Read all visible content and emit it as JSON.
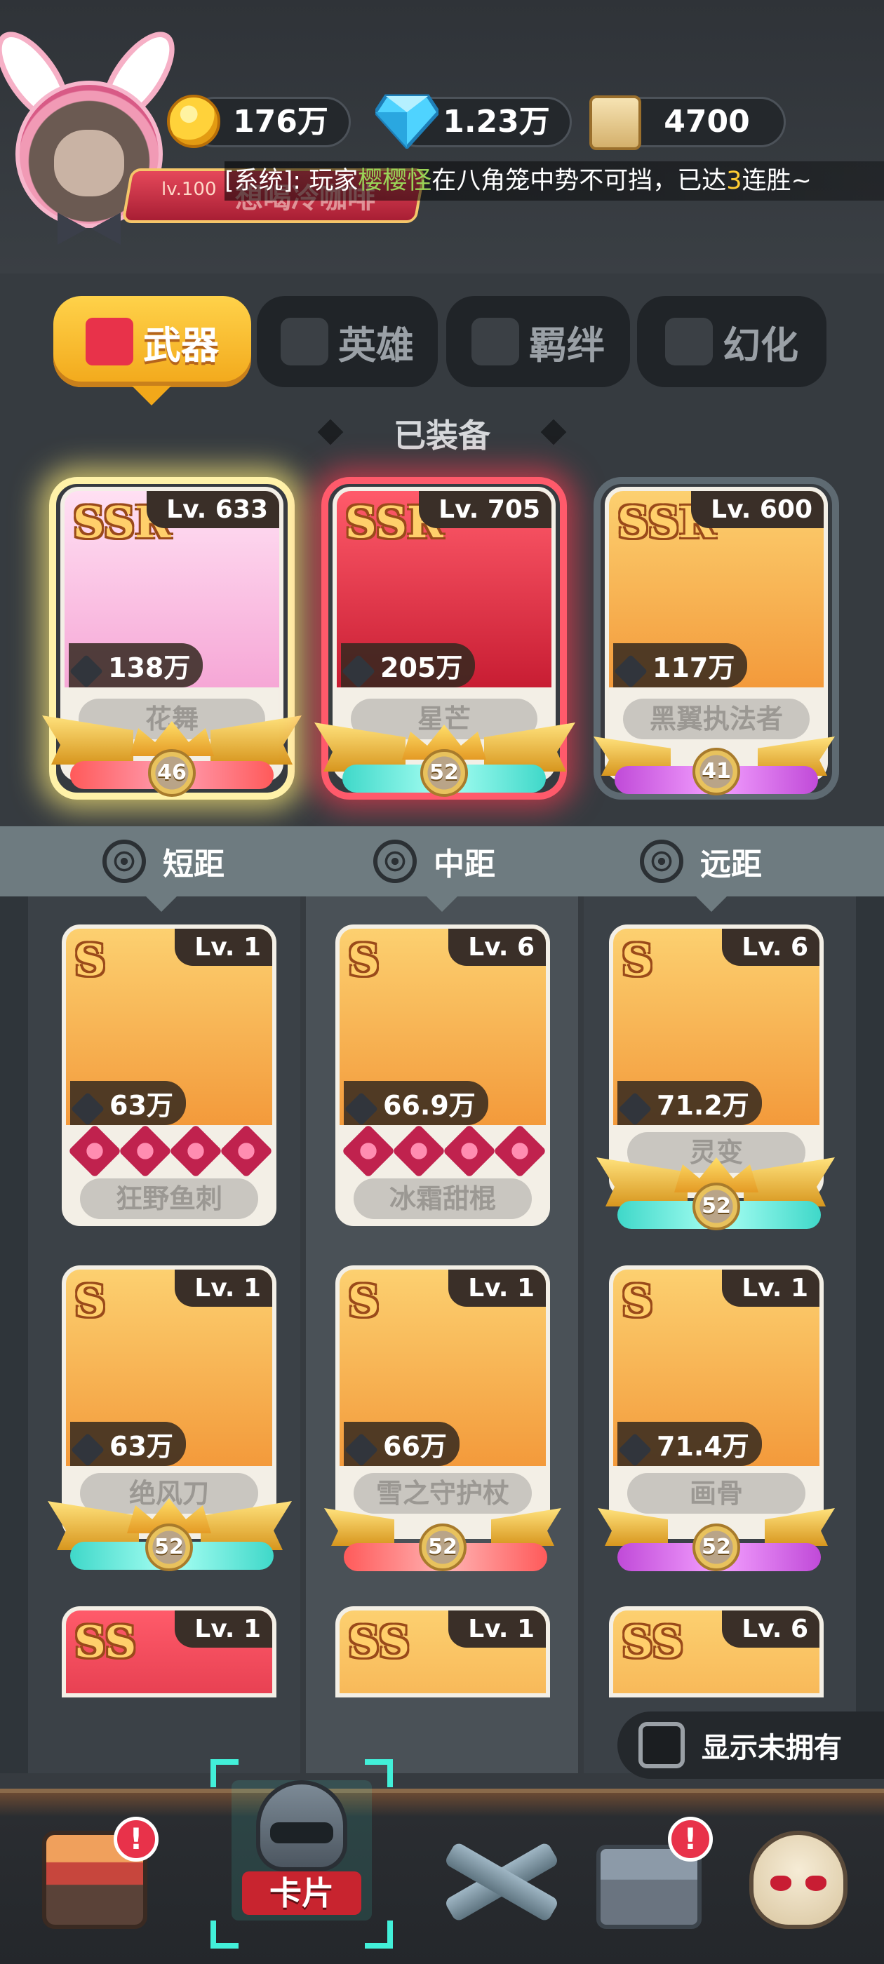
{
  "player": {
    "level": "lv.100",
    "name": "想喝冷咖啡"
  },
  "resources": {
    "coins": "176万",
    "diamonds": "1.23万",
    "scrolls": "4700"
  },
  "ticker": {
    "prefix": "[系统]: 玩家",
    "player": "樱樱怪",
    "middle": "在八角笼中势不可挡，已达",
    "count": "3",
    "suffix": "连胜~"
  },
  "tabs": [
    {
      "label": "武器",
      "icon": "weapon-icon",
      "active": true
    },
    {
      "label": "英雄",
      "icon": "hero-icon",
      "active": false
    },
    {
      "label": "羁绊",
      "icon": "bond-icon",
      "active": false
    },
    {
      "label": "幻化",
      "icon": "transform-icon",
      "active": false
    }
  ],
  "equipped_title": "已装备",
  "equipped": [
    {
      "rank": "SSR",
      "level": "Lv. 633",
      "power": "138万",
      "name": "花舞",
      "star": "46"
    },
    {
      "rank": "SSR",
      "level": "Lv. 705",
      "power": "205万",
      "name": "星芒",
      "star": "52"
    },
    {
      "rank": "SSR",
      "level": "Lv. 600",
      "power": "117万",
      "name": "黑翼执法者",
      "star": "41"
    }
  ],
  "ranges": [
    "短距",
    "中距",
    "远距"
  ],
  "weapons": [
    {
      "rank": "S",
      "level": "Lv. 1",
      "power": "63万",
      "name": "狂野鱼刺"
    },
    {
      "rank": "S",
      "level": "Lv. 6",
      "power": "66.9万",
      "name": "冰霜甜棍"
    },
    {
      "rank": "S",
      "level": "Lv. 6",
      "power": "71.2万",
      "name": "灵变",
      "star": "52"
    },
    {
      "rank": "S",
      "level": "Lv. 1",
      "power": "63万",
      "name": "绝风刀",
      "star": "52"
    },
    {
      "rank": "S",
      "level": "Lv. 1",
      "power": "66万",
      "name": "雪之守护杖",
      "star": "52"
    },
    {
      "rank": "S",
      "level": "Lv. 1",
      "power": "71.4万",
      "name": "画骨",
      "star": "52"
    },
    {
      "rank": "SS",
      "level": "Lv. 1"
    },
    {
      "rank": "SS",
      "level": "Lv. 1"
    },
    {
      "rank": "SS",
      "level": "Lv. 6"
    }
  ],
  "show_unowned": "显示未拥有",
  "nav": {
    "shop_alert": "!",
    "cards_label": "卡片",
    "chest_alert": "!"
  },
  "colors": {
    "accent_yellow": "#f2a81a",
    "alert_red": "#e8324a",
    "background": "#363b40"
  }
}
